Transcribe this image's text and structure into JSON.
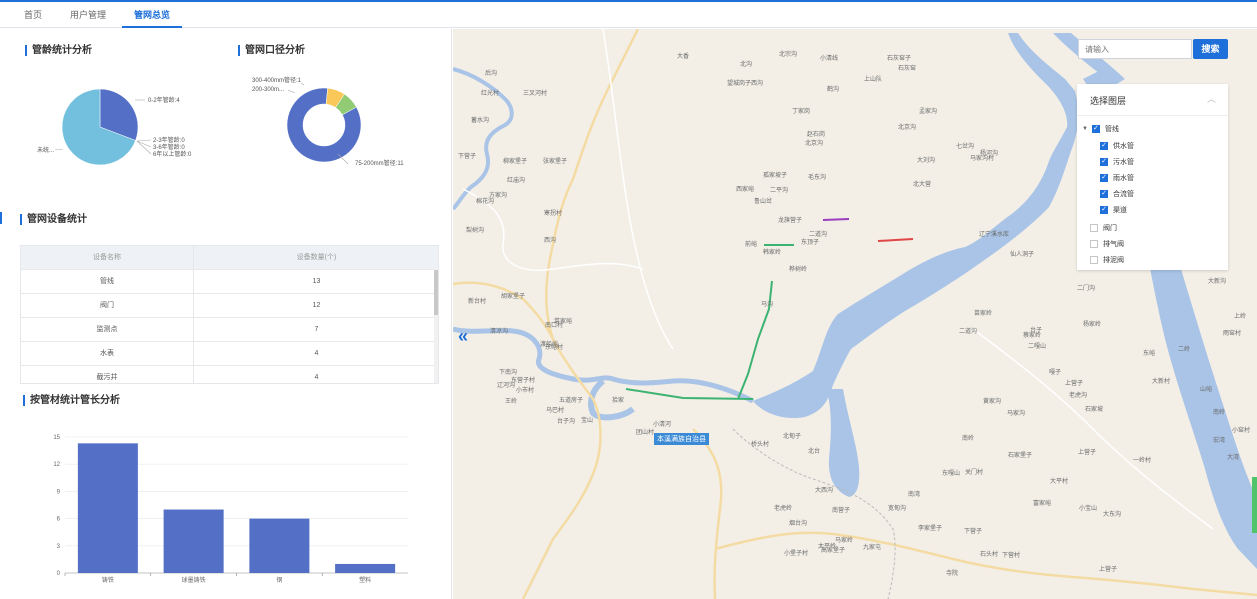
{
  "tabs": [
    {
      "label": "首页",
      "active": false
    },
    {
      "label": "用户管理",
      "active": false
    },
    {
      "label": "管网总览",
      "active": true
    }
  ],
  "age_chart": {
    "title": "管龄统计分析",
    "labels": {
      "a": "0-2年管龄:4",
      "b": "2-3年管龄:0",
      "c": "3-6年管龄:0",
      "d": "6年以上管龄:0",
      "e": "未统..."
    },
    "chart_data": {
      "type": "pie",
      "categories": [
        "0-2年管龄",
        "2-3年管龄",
        "3-6年管龄",
        "6年以上管龄",
        "未统..."
      ],
      "values": [
        4,
        0,
        0,
        0,
        9
      ],
      "colors": [
        "#5470c6",
        "#91cc75",
        "#fac858",
        "#ee6666",
        "#73c0de"
      ]
    }
  },
  "diam_chart": {
    "title": "管网口径分析",
    "labels": {
      "a": "300-400mm管径:1",
      "b": "200-300m...",
      "c": "75-200mm管径:11"
    },
    "chart_data": {
      "type": "pie",
      "categories": [
        "75-200mm管径",
        "200-300m...",
        "300-400mm管径"
      ],
      "values": [
        11,
        1,
        1
      ],
      "colors": [
        "#5470c6",
        "#91cc75",
        "#fac858"
      ]
    }
  },
  "device_table": {
    "title": "管网设备统计",
    "headers": [
      "设备名称",
      "设备数量(个)"
    ],
    "rows": [
      [
        "管线",
        "13"
      ],
      [
        "阀门",
        "12"
      ],
      [
        "监测点",
        "7"
      ],
      [
        "水表",
        "4"
      ],
      [
        "截污井",
        "4"
      ]
    ]
  },
  "material_chart": {
    "title": "按管材统计管长分析",
    "chart_data": {
      "type": "bar",
      "categories": [
        "铸铁",
        "球墨铸铁",
        "钢",
        "塑料"
      ],
      "values": [
        14.3,
        7,
        6,
        1
      ],
      "yticks": [
        0,
        3,
        6,
        9,
        12,
        15
      ],
      "ylim": [
        0,
        15
      ],
      "grid": true,
      "color": "#5470c6"
    }
  },
  "map": {
    "search_placeholder": "请输入",
    "search_button": "搜索",
    "layer_panel": {
      "title": "选择图层",
      "parent": "管线",
      "children": [
        "供水管",
        "污水管",
        "雨水管",
        "合流管",
        "渠道"
      ],
      "others": [
        "阀门",
        "排气阀",
        "排泥阀"
      ]
    },
    "county_label": "本溪满族自治县",
    "labels": [
      [
        "大香",
        224,
        22
      ],
      [
        "小清线",
        367,
        24
      ],
      [
        "北宗沟",
        326,
        20
      ],
      [
        "石灰窑子",
        434,
        24
      ],
      [
        "红光村",
        28,
        59
      ],
      [
        "望城岗子西沟",
        274,
        49
      ],
      [
        "上山队",
        411,
        45
      ],
      [
        "鹤沟",
        374,
        55
      ],
      [
        "后沟",
        32,
        39
      ],
      [
        "三叉河村",
        70,
        59
      ],
      [
        "北沟",
        287,
        30
      ],
      [
        "石灰窑",
        445,
        34
      ],
      [
        "蓄水沟",
        18,
        86
      ],
      [
        "丁家岗",
        339,
        77
      ],
      [
        "北京沟",
        445,
        93
      ],
      [
        "杨河沟",
        527,
        119
      ],
      [
        "七岔沟",
        503,
        112
      ],
      [
        "马家沟村",
        517,
        124
      ],
      [
        "下营子",
        5,
        122
      ],
      [
        "柳家堡子",
        50,
        127
      ],
      [
        "张家堡子",
        90,
        127
      ],
      [
        "红庙沟",
        54,
        146
      ],
      [
        "北京沟",
        352,
        109
      ],
      [
        "孟家沟",
        466,
        77
      ],
      [
        "方家沟",
        36,
        161
      ],
      [
        "棉花沟",
        23,
        167
      ],
      [
        "孤家坡子",
        310,
        141
      ],
      [
        "赵石岗",
        354,
        100
      ],
      [
        "毛东沟",
        355,
        143
      ],
      [
        "大刘沟",
        464,
        126
      ],
      [
        "梨树沟",
        13,
        196
      ],
      [
        "西家峪",
        283,
        155
      ],
      [
        "二平沟",
        317,
        156
      ],
      [
        "鲁山岔",
        301,
        167
      ],
      [
        "寒拐村",
        91,
        179
      ],
      [
        "北大营",
        460,
        150
      ],
      [
        "前峪",
        292,
        210
      ],
      [
        "马沟",
        308,
        270
      ],
      [
        "东顶子",
        348,
        208
      ],
      [
        "龙旗营子",
        325,
        186
      ],
      [
        "西沟",
        91,
        206
      ],
      [
        "桦树岭",
        336,
        235
      ],
      [
        "二道沟",
        356,
        200
      ],
      [
        "韩家岭",
        310,
        218
      ],
      [
        "辽宁溪水库",
        526,
        200
      ],
      [
        "仙人洞子",
        557,
        220
      ],
      [
        "新台村",
        15,
        267
      ],
      [
        "胡家堡子",
        48,
        262
      ],
      [
        "菜家峪",
        101,
        287
      ],
      [
        "东峪村",
        92,
        313
      ],
      [
        "南口村",
        92,
        291
      ],
      [
        "渡船峪",
        87,
        310
      ],
      [
        "清凉沟",
        37,
        297
      ],
      [
        "辽河沟",
        44,
        351
      ],
      [
        "下南沟",
        46,
        338
      ],
      [
        "小市村",
        63,
        356
      ],
      [
        "东营子村",
        58,
        346
      ],
      [
        "王岭",
        52,
        367
      ],
      [
        "乌巴村",
        93,
        376
      ],
      [
        "宝山",
        128,
        386
      ],
      [
        "五道房子",
        106,
        366
      ],
      [
        "台子沟",
        104,
        387
      ],
      [
        "拾家",
        159,
        366
      ],
      [
        "团山村",
        183,
        398
      ],
      [
        "大车村",
        210,
        404
      ],
      [
        "桥头村",
        298,
        410
      ],
      [
        "小清河",
        200,
        390
      ],
      [
        "北甸子",
        330,
        402
      ],
      [
        "北台",
        355,
        417
      ],
      [
        "大西沟",
        362,
        456
      ],
      [
        "老虎岭",
        321,
        474
      ],
      [
        "南营子",
        379,
        476
      ],
      [
        "烟台沟",
        336,
        489
      ],
      [
        "太平岭",
        365,
        512
      ],
      [
        "小堡子村",
        331,
        519
      ],
      [
        "高家堡子",
        368,
        516
      ],
      [
        "马家岭",
        382,
        506
      ],
      [
        "李家堡子",
        465,
        494
      ],
      [
        "宽甸沟",
        435,
        474
      ],
      [
        "南湾",
        455,
        460
      ],
      [
        "九家屯",
        410,
        513
      ],
      [
        "寺院",
        493,
        539
      ],
      [
        "石头村",
        527,
        520
      ],
      [
        "下营村",
        549,
        521
      ],
      [
        "大平村",
        597,
        447
      ],
      [
        "富家峪",
        580,
        469
      ],
      [
        "小宝山",
        626,
        474
      ],
      [
        "大东沟",
        650,
        480
      ],
      [
        "上营子",
        646,
        535
      ],
      [
        "宏湾",
        760,
        406
      ],
      [
        "大湾",
        774,
        423
      ],
      [
        "一岭村",
        680,
        426
      ],
      [
        "山峪",
        747,
        355
      ],
      [
        "二岭",
        725,
        315
      ],
      [
        "东峪",
        690,
        319
      ],
      [
        "南岭",
        760,
        378
      ],
      [
        "雨窑村",
        770,
        299
      ],
      [
        "小窑村",
        779,
        396
      ],
      [
        "蔡家岭",
        570,
        301
      ],
      [
        "石家坡",
        632,
        375
      ],
      [
        "上营子",
        612,
        349
      ],
      [
        "台子",
        577,
        296
      ],
      [
        "二嘎山",
        575,
        312
      ],
      [
        "嘎子",
        596,
        338
      ],
      [
        "杨家岭",
        630,
        290
      ],
      [
        "苗家岭",
        521,
        279
      ],
      [
        "二道沟",
        506,
        297
      ],
      [
        "黄家沟",
        530,
        367
      ],
      [
        "马家沟",
        554,
        379
      ],
      [
        "东嘎山",
        489,
        439
      ],
      [
        "关门村",
        512,
        438
      ],
      [
        "二门沟",
        624,
        254
      ],
      [
        "大新沟",
        755,
        247
      ],
      [
        "上岭",
        781,
        282
      ],
      [
        "老虎沟",
        616,
        361
      ],
      [
        "大新村",
        699,
        347
      ],
      [
        "上营子",
        625,
        418
      ],
      [
        "石家堡子",
        555,
        421
      ],
      [
        "南岭",
        509,
        404
      ],
      [
        "下营子",
        511,
        497
      ]
    ]
  }
}
